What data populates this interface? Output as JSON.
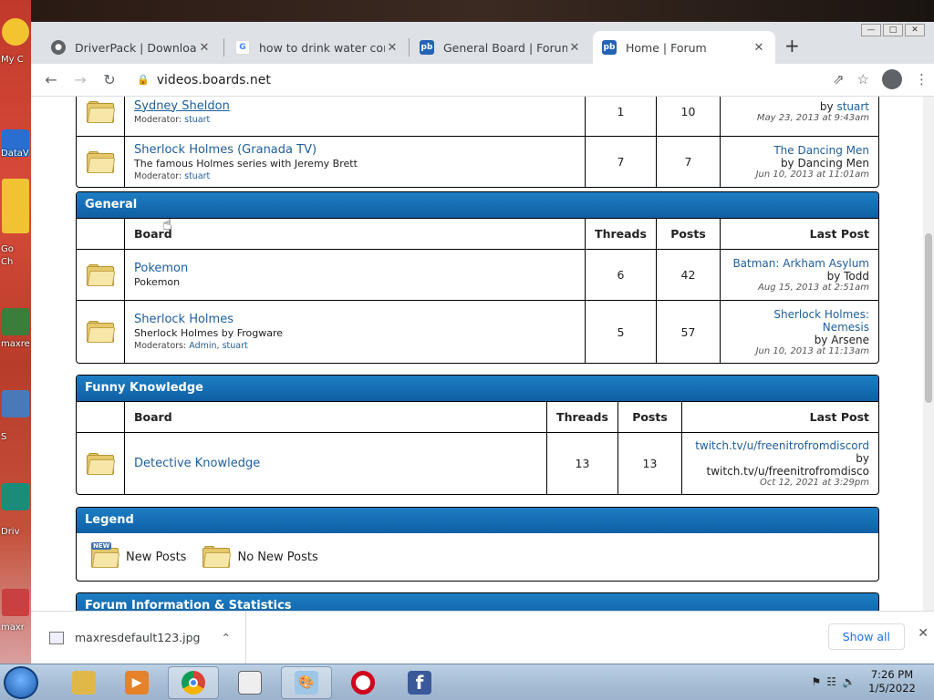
{
  "desktop": {
    "labels": [
      "My C",
      "DataV",
      "Go",
      "Ch",
      "maxre",
      "S",
      "Driv",
      "maxr"
    ]
  },
  "browser": {
    "tabs": [
      {
        "title": "DriverPack | Download fre",
        "favicon": "globe-icon"
      },
      {
        "title": "how to drink water correc",
        "favicon": "google-icon"
      },
      {
        "title": "General Board | Forum",
        "favicon": "pb"
      },
      {
        "title": "Home | Forum",
        "favicon": "pb"
      }
    ],
    "url": "videos.boards.net"
  },
  "forum": {
    "top_rows": [
      {
        "board": "Sydney Sheldon",
        "moderator_label": "Moderator:",
        "moderators": "stuart",
        "threads": "1",
        "posts": "10",
        "last_post_by_label": "by",
        "last_post_by": "stuart",
        "last_post_date": "May 23, 2013 at 9:43am"
      },
      {
        "board": "Sherlock Holmes (Granada TV)",
        "description": "The famous Holmes series with Jeremy Brett",
        "moderator_label": "Moderator:",
        "moderators": "stuart",
        "threads": "7",
        "posts": "7",
        "last_post_title": "The Dancing Men",
        "last_post_by_label": "by",
        "last_post_by": "Dancing Men",
        "last_post_date": "Jun 10, 2013 at 11:01am"
      }
    ],
    "general": {
      "title": "General",
      "headers": {
        "board": "Board",
        "threads": "Threads",
        "posts": "Posts",
        "last_post": "Last Post"
      },
      "rows": [
        {
          "board": "Pokemon",
          "description": "Pokemon",
          "threads": "6",
          "posts": "42",
          "last_post_title": "Batman: Arkham Asylum",
          "last_post_by": "by Todd",
          "last_post_date": "Aug 15, 2013 at 2:51am"
        },
        {
          "board": "Sherlock Holmes",
          "description": "Sherlock Holmes by Frogware",
          "moderator_label": "Moderators:",
          "moderators": "Admin, stuart",
          "threads": "5",
          "posts": "57",
          "last_post_title_line1": "Sherlock Holmes:",
          "last_post_title_line2": "Nemesis",
          "last_post_by": "by Arsene",
          "last_post_date": "Jun 10, 2013 at 11:13am"
        }
      ]
    },
    "funny": {
      "title": "Funny Knowledge",
      "headers": {
        "board": "Board",
        "threads": "Threads",
        "posts": "Posts",
        "last_post": "Last Post"
      },
      "rows": [
        {
          "board": "Detective Knowledge",
          "threads": "13",
          "posts": "13",
          "last_post_title": "twitch.tv/u/freenitrofromdiscord",
          "last_post_by_label": "by",
          "last_post_by": "twitch.tv/u/freenitrofromdisco",
          "last_post_date": "Oct 12, 2021 at 3:29pm"
        }
      ]
    },
    "legend": {
      "title": "Legend",
      "new_posts": "New Posts",
      "no_new_posts": "No New Posts",
      "new_badge": "NEW"
    },
    "stats_title": "Forum Information & Statistics"
  },
  "downloads": {
    "file": "maxresdefault123.jpg",
    "show_all": "Show all"
  },
  "taskbar": {
    "time": "7:26 PM",
    "date": "1/5/2022"
  },
  "colors": {
    "category_header": "#1474bd",
    "link": "#1f5e9c",
    "chrome_tabstrip": "#dee1e6"
  }
}
